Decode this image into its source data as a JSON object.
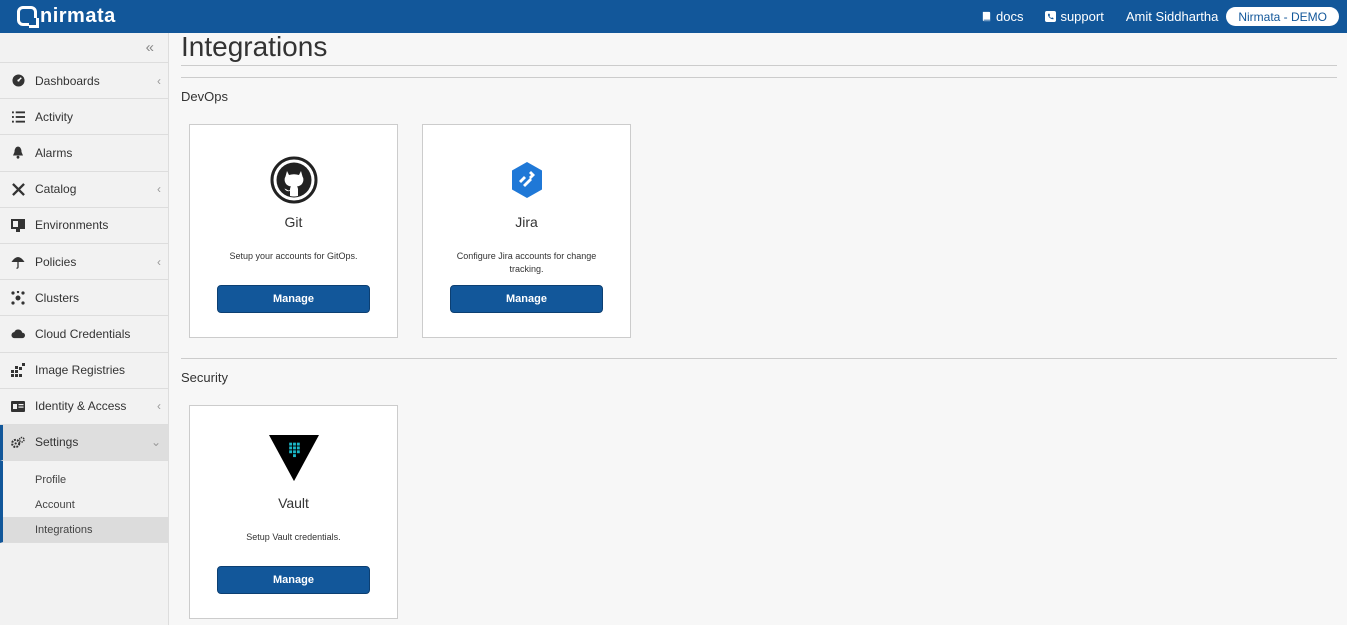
{
  "header": {
    "logo_text": "nirmata",
    "docs_label": "docs",
    "support_label": "support",
    "user_name": "Amit Siddhartha",
    "org_label": "Nirmata - DEMO",
    "bar_color": "#12579a"
  },
  "sidebar": {
    "collapse_glyph": "«",
    "items": [
      {
        "label": "Dashboards",
        "icon": "dashboard-icon",
        "expandable": true
      },
      {
        "label": "Activity",
        "icon": "list-icon",
        "expandable": false
      },
      {
        "label": "Alarms",
        "icon": "bell-icon",
        "expandable": false
      },
      {
        "label": "Catalog",
        "icon": "tools-icon",
        "expandable": true
      },
      {
        "label": "Environments",
        "icon": "environment-icon",
        "expandable": false
      },
      {
        "label": "Policies",
        "icon": "umbrella-icon",
        "expandable": true
      },
      {
        "label": "Clusters",
        "icon": "cluster-icon",
        "expandable": false
      },
      {
        "label": "Cloud Credentials",
        "icon": "cloud-icon",
        "expandable": false
      },
      {
        "label": "Image Registries",
        "icon": "registry-icon",
        "expandable": false
      },
      {
        "label": "Identity & Access",
        "icon": "id-card-icon",
        "expandable": true
      },
      {
        "label": "Settings",
        "icon": "gears-icon",
        "expandable": true,
        "active": true
      }
    ],
    "settings_sub": [
      {
        "label": "Profile"
      },
      {
        "label": "Account"
      },
      {
        "label": "Integrations",
        "selected": true
      }
    ]
  },
  "main": {
    "title": "Integrations",
    "sections": [
      {
        "label": "DevOps",
        "cards": [
          {
            "name": "Git",
            "icon": "github-icon",
            "description": "Setup your accounts for GitOps.",
            "button": "Manage"
          },
          {
            "name": "Jira",
            "icon": "jira-icon",
            "description": "Configure Jira accounts for change tracking.",
            "button": "Manage"
          }
        ]
      },
      {
        "label": "Security",
        "cards": [
          {
            "name": "Vault",
            "icon": "vault-icon",
            "description": "Setup Vault credentials.",
            "button": "Manage"
          }
        ]
      }
    ]
  }
}
